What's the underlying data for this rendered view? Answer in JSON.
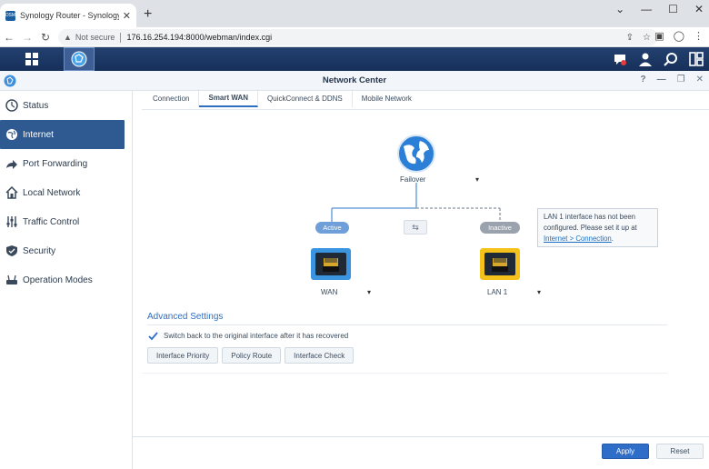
{
  "browser": {
    "tab_title": "Synology Router - SynologyRou",
    "tab_favicon": "DSM",
    "not_secure": "Not secure",
    "url": "176.16.254.194:8000/webman/index.cgi"
  },
  "window": {
    "title": "Network Center"
  },
  "sidebar": {
    "items": [
      {
        "label": "Status",
        "icon": "status-icon"
      },
      {
        "label": "Internet",
        "icon": "globe-icon",
        "active": true
      },
      {
        "label": "Port Forwarding",
        "icon": "arrow-icon"
      },
      {
        "label": "Local Network",
        "icon": "home-icon"
      },
      {
        "label": "Traffic Control",
        "icon": "sliders-icon"
      },
      {
        "label": "Security",
        "icon": "shield-icon"
      },
      {
        "label": "Operation Modes",
        "icon": "router-icon"
      }
    ]
  },
  "tabs": [
    "Connection",
    "Smart WAN",
    "QuickConnect & DDNS",
    "Mobile Network"
  ],
  "active_tab": "Smart WAN",
  "diagram": {
    "mode": "Failover",
    "active_label": "Active",
    "inactive_label": "Inactive",
    "wan_label": "WAN",
    "lan_label": "LAN 1"
  },
  "tooltip": {
    "text": "LAN 1 interface has not been configured. Please set it up at",
    "link": "Internet > Connection",
    "end": "."
  },
  "advanced": {
    "title": "Advanced Settings",
    "checkbox_label": "Switch back to the original interface after it has recovered",
    "checkbox_checked": true,
    "buttons": [
      "Interface Priority",
      "Policy Route",
      "Interface Check"
    ]
  },
  "footer": {
    "apply": "Apply",
    "reset": "Reset"
  },
  "colors": {
    "active_pill": "#6f9fd8",
    "inactive_pill": "#9aa3ad",
    "wan_port": "#3b94e0",
    "lan_port": "#f5c21b",
    "sidebar_active": "#2f5a91"
  }
}
